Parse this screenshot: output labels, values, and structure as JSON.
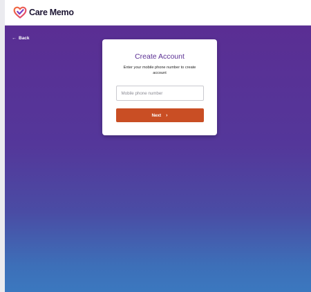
{
  "header": {
    "brand_name": "Care Memo"
  },
  "nav": {
    "back_label": "Back"
  },
  "card": {
    "title": "Create Account",
    "subtitle": "Enter your mobile phone number to create account",
    "phone_field": {
      "placeholder": "Mobile phone number",
      "value": ""
    },
    "next_label": "Next"
  },
  "icons": {
    "logo": "heart-check-logo",
    "back": "arrow-left-icon",
    "next": "chevron-right-icon"
  },
  "colors": {
    "brand_purple": "#5a2e93",
    "gradient_bottom_blue": "#3b78bf",
    "button_orange": "#c94e24",
    "logo_orange": "#f26b3a",
    "logo_purple": "#7b3fc4"
  }
}
